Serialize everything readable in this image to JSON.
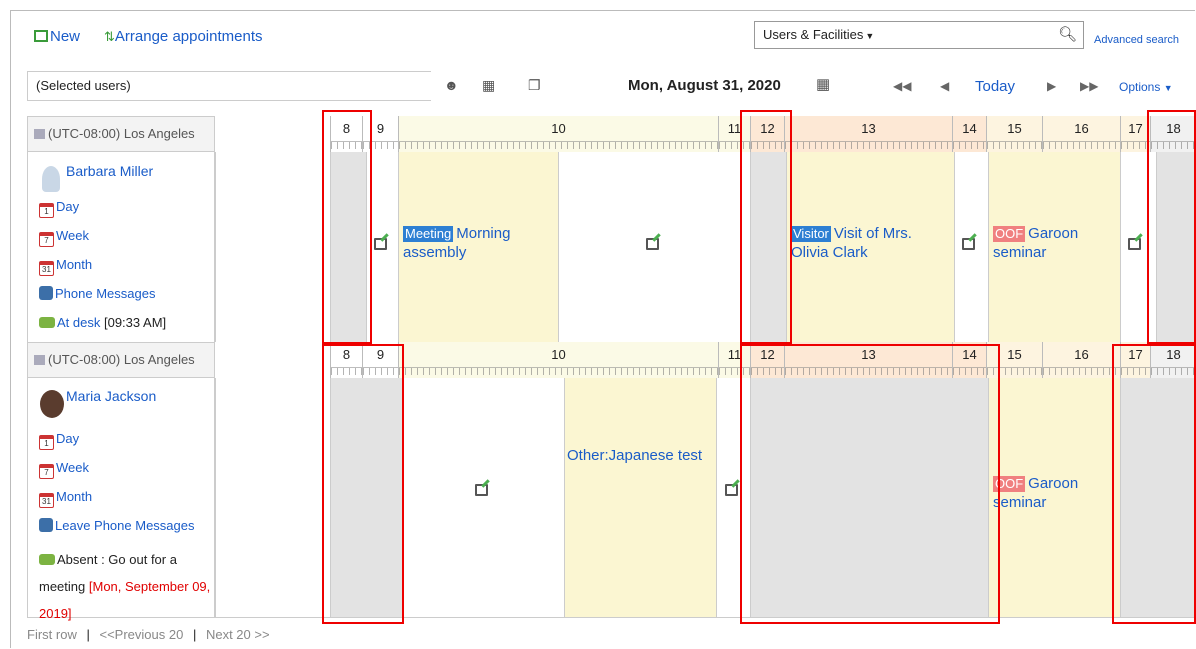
{
  "toolbar": {
    "new_label": "New",
    "arrange_label": "Arrange appointments",
    "search_scope": "Users & Facilities",
    "advanced_search": "Advanced search",
    "users_box": "(Selected users)",
    "date": "Mon, August 31, 2020",
    "today": "Today",
    "options": "Options"
  },
  "hours": [
    "8",
    "9",
    "10",
    "11",
    "12",
    "13",
    "14",
    "15",
    "16",
    "17",
    "18"
  ],
  "rows": [
    {
      "timezone": "(UTC-08:00) Los Angeles",
      "user": "Barbara Miller",
      "links": [
        "Day",
        "Week",
        "Month",
        "Phone Messages"
      ],
      "presence_status": "At desk",
      "presence_time": "[09:33 AM]",
      "events": [
        {
          "badge": "Meeting",
          "title": "Morning assembly"
        },
        {
          "badge": "Visitor",
          "title": "Visit of Mrs. Olivia Clark"
        },
        {
          "badge": "OOF",
          "title": "Garoon seminar"
        }
      ]
    },
    {
      "timezone": "(UTC-08:00) Los Angeles",
      "user": "Maria Jackson",
      "links": [
        "Day",
        "Week",
        "Month",
        "Leave Phone Messages"
      ],
      "presence_status": "Absent : Go out for a meeting",
      "presence_date": "[Mon, September 09, 2019]",
      "events": [
        {
          "badge": "",
          "title": "Other:Japanese test"
        },
        {
          "badge": "OOF",
          "title": "Garoon seminar"
        }
      ]
    }
  ],
  "pager": {
    "first": "First row",
    "prev": "<<Previous 20",
    "next": "Next 20 >>",
    "sep": "|"
  },
  "colors": {
    "meeting": "#2d7fd3",
    "visitor": "#2d7fd3",
    "oof": "#f08080",
    "event_bg": "#fbf6d2",
    "offhours": "#e3e3e3",
    "afternoon_head": "#fde8d5",
    "highlight": "#e00000"
  }
}
